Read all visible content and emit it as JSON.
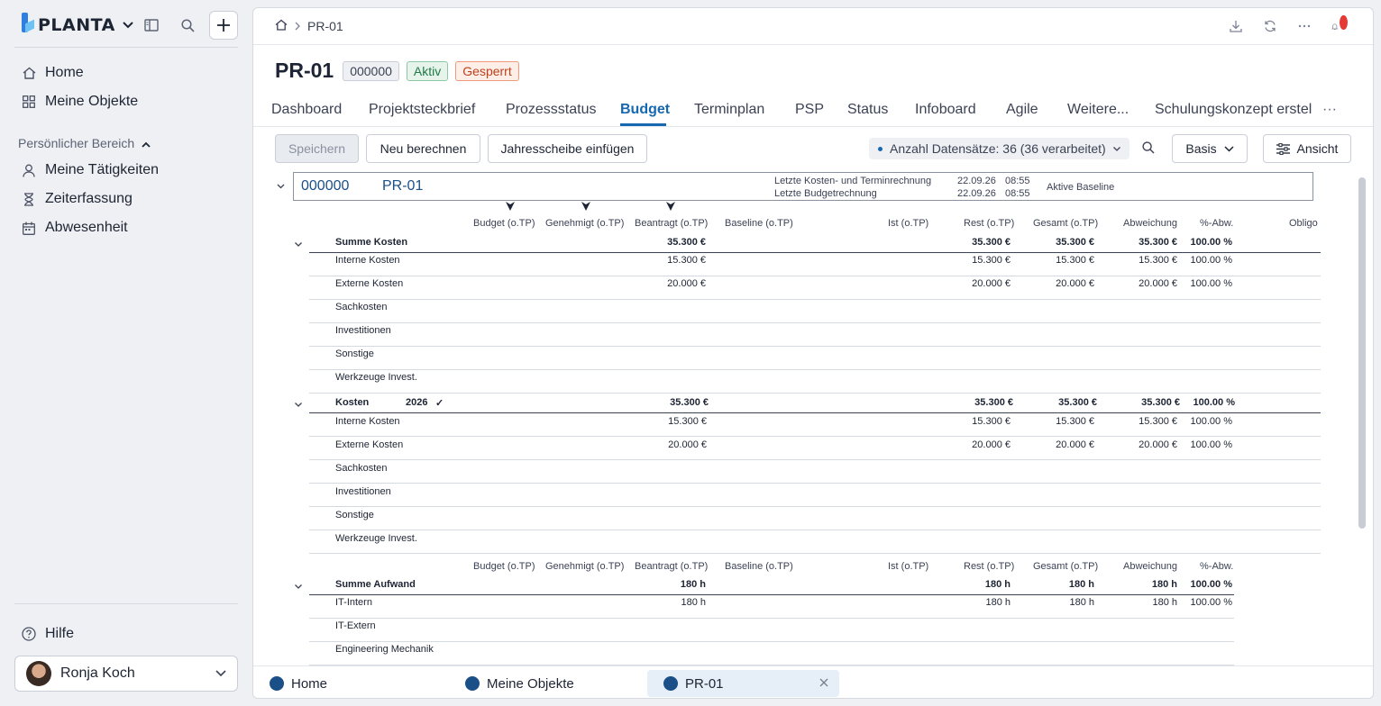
{
  "sidebar": {
    "logo_text": "PLANTA",
    "nav": [
      {
        "label": "Home",
        "icon": "home-icon"
      },
      {
        "label": "Meine Objekte",
        "icon": "grid-icon"
      }
    ],
    "section_label": "Persönlicher Bereich",
    "personal": [
      {
        "label": "Meine Tätigkeiten",
        "icon": "person-icon"
      },
      {
        "label": "Zeiterfassung",
        "icon": "hourglass-icon"
      },
      {
        "label": "Abwesenheit",
        "icon": "calendar-icon"
      }
    ],
    "help_label": "Hilfe",
    "user_name": "Ronja Koch"
  },
  "breadcrumb": {
    "current": "PR-01"
  },
  "header": {
    "title": "PR-01",
    "badges": {
      "id": "000000",
      "status": "Aktiv",
      "lock": "Gesperrt"
    }
  },
  "tabs": [
    {
      "label": "Dashboard"
    },
    {
      "label": "Projektsteckbrief"
    },
    {
      "label": "Prozessstatus"
    },
    {
      "label": "Budget"
    },
    {
      "label": "Terminplan"
    },
    {
      "label": "PSP"
    },
    {
      "label": "Status"
    },
    {
      "label": "Infoboard"
    },
    {
      "label": "Agile"
    },
    {
      "label": "Weitere..."
    },
    {
      "label": "Schulungskonzept erstel"
    }
  ],
  "tabs_more": "···",
  "toolbar": {
    "save": "Speichern",
    "recalc": "Neu berechnen",
    "insert_year": "Jahresscheibe einfügen",
    "records": "Anzahl Datensätze: 36 (36 verarbeitet)",
    "basis": "Basis",
    "view": "Ansicht"
  },
  "project": {
    "id": "000000",
    "name": "PR-01",
    "last_cost_label": "Letzte Kosten- und Terminrechnung",
    "last_cost_date": "22.09.26",
    "last_cost_time": "08:55",
    "last_budget_label": "Letzte Budgetrechnung",
    "last_budget_date": "22.09.26",
    "last_budget_time": "08:55",
    "baseline_label": "Aktive Baseline"
  },
  "columns": {
    "budget": "Budget (o.TP)",
    "genehmigt": "Genehmigt (o.TP)",
    "beantragt": "Beantragt (o.TP)",
    "baseline": "Baseline (o.TP)",
    "ist": "Ist (o.TP)",
    "rest": "Rest (o.TP)",
    "gesamt": "Gesamt (o.TP)",
    "abweichung": "Abweichung",
    "pabw": "%-Abw.",
    "obligo": "Obligo"
  },
  "summe_kosten": {
    "label": "Summe Kosten",
    "beantragt": "35.300 €",
    "rest": "35.300 €",
    "gesamt": "35.300 €",
    "abw": "35.300 €",
    "pabw": "100.00 %",
    "rows": [
      {
        "label": "Interne Kosten",
        "beantragt": "15.300 €",
        "rest": "15.300 €",
        "gesamt": "15.300 €",
        "abw": "15.300 €",
        "pabw": "100.00 %"
      },
      {
        "label": "Externe Kosten",
        "beantragt": "20.000 €",
        "rest": "20.000 €",
        "gesamt": "20.000 €",
        "abw": "20.000 €",
        "pabw": "100.00 %"
      },
      {
        "label": "Sachkosten"
      },
      {
        "label": "Investitionen"
      },
      {
        "label": "Sonstige"
      },
      {
        "label": "Werkzeuge Invest."
      }
    ]
  },
  "kosten_year": {
    "label": "Kosten",
    "year": "2026",
    "check": "✓",
    "beantragt": "35.300 €",
    "rest": "35.300 €",
    "gesamt": "35.300 €",
    "abw": "35.300 €",
    "pabw": "100.00 %",
    "rows": [
      {
        "label": "Interne Kosten",
        "beantragt": "15.300 €",
        "rest": "15.300 €",
        "gesamt": "15.300 €",
        "abw": "15.300 €",
        "pabw": "100.00 %"
      },
      {
        "label": "Externe Kosten",
        "beantragt": "20.000 €",
        "rest": "20.000 €",
        "gesamt": "20.000 €",
        "abw": "20.000 €",
        "pabw": "100.00 %"
      },
      {
        "label": "Sachkosten"
      },
      {
        "label": "Investitionen"
      },
      {
        "label": "Sonstige"
      },
      {
        "label": "Werkzeuge Invest."
      }
    ]
  },
  "summe_aufwand": {
    "label": "Summe Aufwand",
    "beantragt": "180 h",
    "rest": "180 h",
    "gesamt": "180 h",
    "abw": "180 h",
    "pabw": "100.00 %",
    "rows": [
      {
        "label": "IT-Intern",
        "beantragt": "180 h",
        "rest": "180 h",
        "gesamt": "180 h",
        "abw": "180 h",
        "pabw": "100.00 %"
      },
      {
        "label": "IT-Extern"
      },
      {
        "label": "Engineering Mechanik"
      }
    ]
  },
  "bottom_tabs": [
    {
      "label": "Home"
    },
    {
      "label": "Meine Objekte"
    },
    {
      "label": "PR-01"
    }
  ],
  "colors": {
    "accent": "#1668b0",
    "aktiv": "#1e7a45",
    "gesperrt": "#c0401b"
  }
}
